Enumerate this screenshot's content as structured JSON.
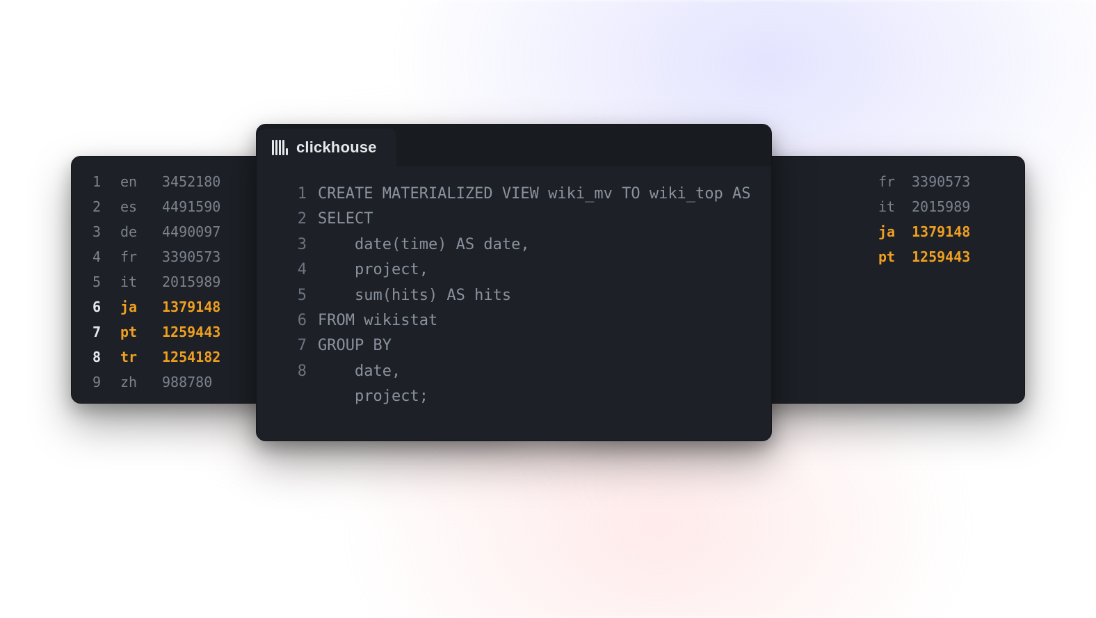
{
  "tab_label": "clickhouse",
  "code_lines": [
    {
      "n": "1",
      "t": "CREATE MATERIALIZED VIEW wiki_mv TO wiki_top AS"
    },
    {
      "n": "2",
      "t": "SELECT"
    },
    {
      "n": "3",
      "t": "    date(time) AS date,"
    },
    {
      "n": "4",
      "t": "    project,"
    },
    {
      "n": "5",
      "t": "    sum(hits) AS hits"
    },
    {
      "n": "6",
      "t": "FROM wikistat"
    },
    {
      "n": "7",
      "t": "GROUP BY"
    },
    {
      "n": "8",
      "t": "    date,"
    },
    {
      "n": "",
      "t": "    project;"
    }
  ],
  "left_results": [
    {
      "n": "1",
      "proj": "en",
      "hits": "3452180",
      "hl": false
    },
    {
      "n": "2",
      "proj": "es",
      "hits": "4491590",
      "hl": false
    },
    {
      "n": "3",
      "proj": "de",
      "hits": "4490097",
      "hl": false
    },
    {
      "n": "4",
      "proj": "fr",
      "hits": "3390573",
      "hl": false
    },
    {
      "n": "5",
      "proj": "it",
      "hits": "2015989",
      "hl": false
    },
    {
      "n": "6",
      "proj": "ja",
      "hits": "1379148",
      "hl": true
    },
    {
      "n": "7",
      "proj": "pt",
      "hits": "1259443",
      "hl": true
    },
    {
      "n": "8",
      "proj": "tr",
      "hits": "1254182",
      "hl": true
    },
    {
      "n": "9",
      "proj": "zh",
      "hits": "988780",
      "hl": false
    }
  ],
  "right_results": [
    {
      "proj": "fr",
      "hits": "3390573",
      "hl": false
    },
    {
      "proj": "it",
      "hits": "2015989",
      "hl": false
    },
    {
      "proj": "ja",
      "hits": "1379148",
      "hl": true
    },
    {
      "proj": "pt",
      "hits": "1259443",
      "hl": true
    }
  ]
}
